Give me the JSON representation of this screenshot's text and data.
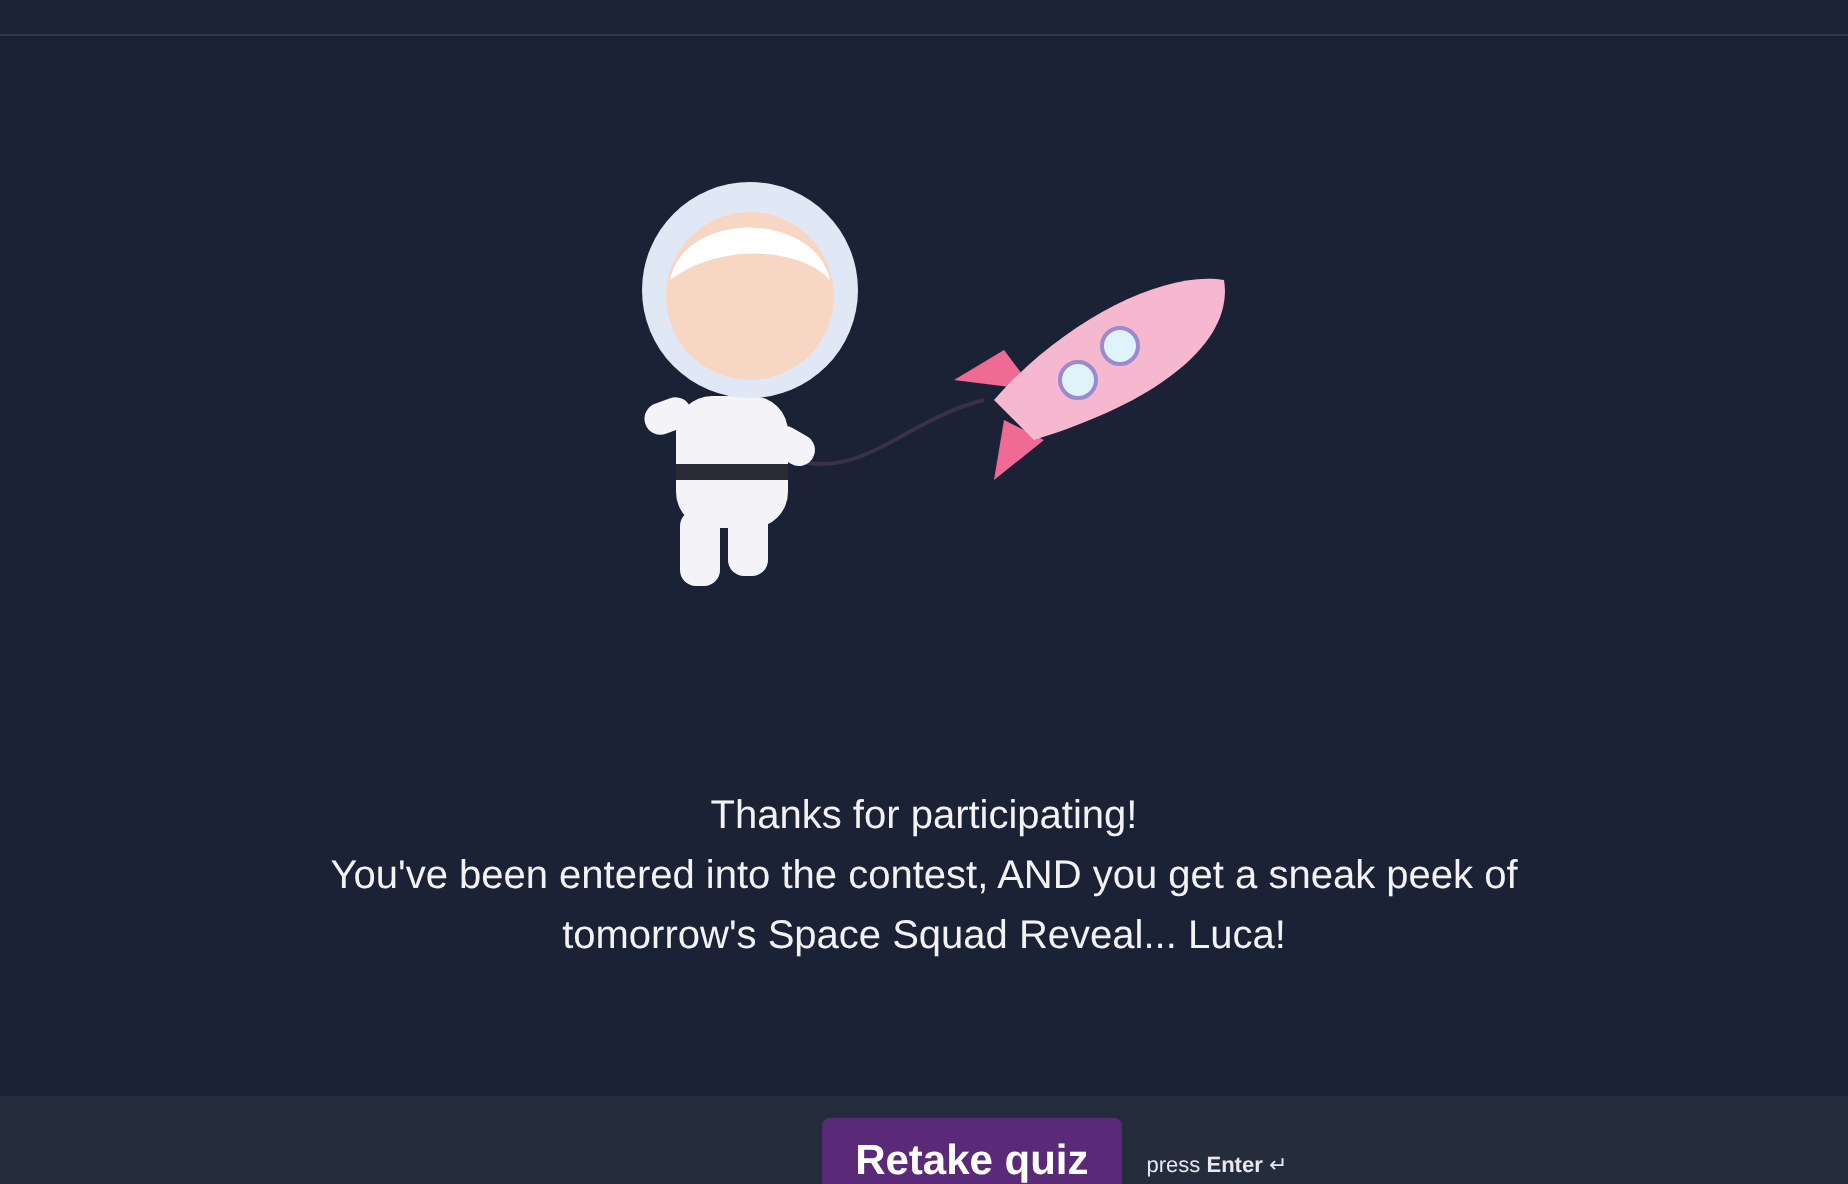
{
  "message": {
    "lines": [
      "Thanks for participating!",
      "You've been entered into the contest, AND you get a sneak peek of",
      "tomorrow's Space Squad Reveal... Luca!"
    ]
  },
  "footer": {
    "button": "Retake quiz",
    "hint": "press **Enter** ↵"
  }
}
